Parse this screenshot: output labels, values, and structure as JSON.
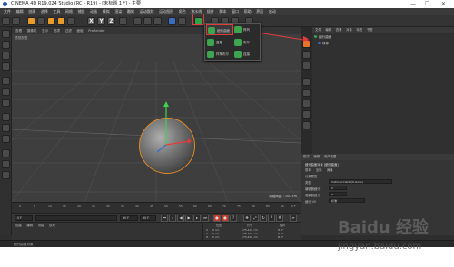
{
  "window": {
    "title": "CINEMA 4D R19.024 Studio (RC - R19) - [未标题 1 *] - 主要",
    "minimize": "—",
    "maximize": "☐",
    "close": "✕"
  },
  "menubar": [
    "文件",
    "编辑",
    "创建",
    "选择",
    "工具",
    "网格",
    "捕捉",
    "动画",
    "模拟",
    "渲染",
    "雕刻",
    "运动跟踪",
    "运动图形",
    "角色",
    "流水线",
    "插件",
    "脚本",
    "窗口",
    "帮助",
    "界面",
    "启动"
  ],
  "toolbar": {
    "xyz": [
      "X",
      "Y",
      "Z"
    ]
  },
  "viewport": {
    "menu": [
      "查看",
      "摄像机",
      "显示",
      "选项",
      "过滤",
      "面板",
      "ProRender"
    ],
    "label": "透视视图",
    "grid_label": "网格间距 : 100 cm"
  },
  "popup": {
    "items": [
      {
        "label": "细分曲面",
        "selected": true
      },
      {
        "label": "阵列",
        "selected": false
      },
      {
        "label": "晶格",
        "selected": false
      },
      {
        "label": "布尔",
        "selected": false
      },
      {
        "label": "样条布尔",
        "selected": false
      },
      {
        "label": "连接",
        "selected": false
      }
    ]
  },
  "objects": {
    "menu": [
      "文件",
      "编辑",
      "查看",
      "对象",
      "标签",
      "书签"
    ],
    "rows": [
      "细分曲面",
      "球体"
    ]
  },
  "attributes": {
    "menu": [
      "模式",
      "编辑",
      "用户数据"
    ],
    "header": "细分曲面对象 [细分曲面]",
    "tabs": [
      "基本",
      "坐标",
      "对象"
    ],
    "section": "对象属性",
    "fields": [
      {
        "label": "类型",
        "value": "Catmull-Clark (N-Gons)"
      },
      {
        "label": "编辑器细分",
        "value": "2"
      },
      {
        "label": "渲染器细分",
        "value": "3"
      },
      {
        "label": "细分 UV",
        "value": "标准"
      }
    ]
  },
  "timeline": {
    "ticks": [
      "0",
      "5",
      "10",
      "15",
      "20",
      "25",
      "30",
      "35",
      "40",
      "45",
      "50",
      "55",
      "60",
      "65",
      "70",
      "75",
      "80",
      "85",
      "90"
    ],
    "end_frame": "0 F",
    "start_field": "0 F",
    "current_field": "90 F",
    "end_field": "90 F"
  },
  "material": {
    "menu": [
      "创建",
      "编辑",
      "功能",
      "纹理"
    ]
  },
  "coords": {
    "headers": [
      "位置",
      "尺寸",
      "旋转"
    ],
    "rows": [
      {
        "axis": "X",
        "pos": "0 cm",
        "size": "175.494 cm",
        "rot": "H  0°"
      },
      {
        "axis": "Y",
        "pos": "0 cm",
        "size": "175.494 cm",
        "rot": "P  0°"
      },
      {
        "axis": "Z",
        "pos": "0 cm",
        "size": "175.494 cm",
        "rot": "B  0°"
      }
    ],
    "mode": "对象 (相对)",
    "size_mode": "绝对尺寸",
    "apply": "应用"
  },
  "status": "细分曲面对象",
  "watermark": {
    "brand": "Baidu 经验",
    "url": "jingyan.baidu.com"
  }
}
